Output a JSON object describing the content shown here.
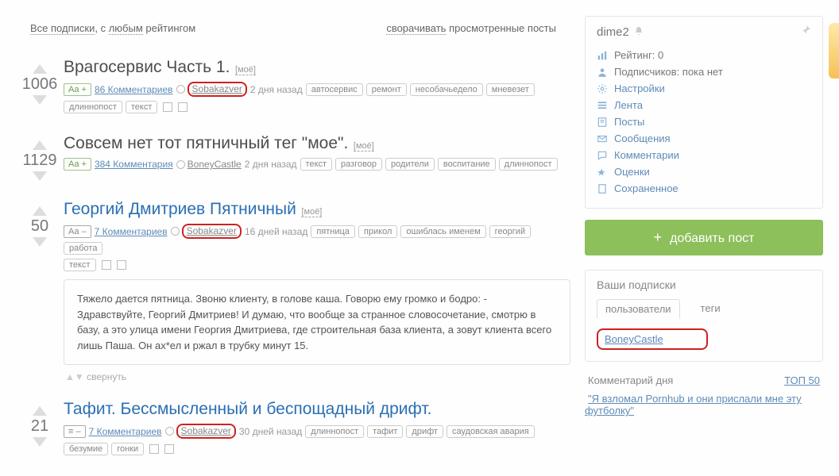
{
  "filter": {
    "all_subs": "Все подписки",
    "with": ", с",
    "any": "любым",
    "rating": "рейтингом",
    "collapse": "сворачивать",
    "viewed": "просмотренные посты"
  },
  "posts": [
    {
      "score": "1006",
      "title": "Врагосервис Часть 1.",
      "title_link": false,
      "moe": "[моё]",
      "aa": "Aa +",
      "aa_plus": true,
      "comments": "86 Комментариев",
      "author": "Sobakazver",
      "author_circled": true,
      "time": "2 дня назад",
      "tags": [
        "автосервис",
        "ремонт",
        "несобачьедело",
        "мневезет"
      ],
      "tags2": [
        "длиннопост",
        "текст"
      ]
    },
    {
      "score": "1129",
      "title": "Совсем нет тот пятничный тег \"мое\".",
      "title_link": false,
      "moe": "[моё]",
      "aa": "Aa +",
      "aa_plus": true,
      "comments": "384 Комментария",
      "author": "BoneyCastle",
      "author_circled": false,
      "time": "2 дня назад",
      "tags": [
        "текст",
        "разговор",
        "родители",
        "воспитание",
        "длиннопост"
      ],
      "tags2": []
    },
    {
      "score": "50",
      "title": "Георгий Дмитриев Пятничный",
      "title_link": true,
      "moe": "[моё]",
      "aa": "Aa –",
      "aa_plus": false,
      "comments": "7 Комментариев",
      "author": "Sobakazver",
      "author_circled": true,
      "time": "16 дней назад",
      "tags": [
        "пятница",
        "прикол",
        "ошиблась именем",
        "георгий",
        "работа"
      ],
      "tags2": [
        "текст"
      ],
      "excerpt": "Тяжело дается пятница. Звоню клиенту, в голове каша. Говорю ему громко и бодро: - Здравствуйте, Георгий Дмитриев! И думаю, что вообще за странное словосочетание, смотрю в базу, а это улица имени Георгия Дмитриева, где строительная база клиента, а зовут клиента всего лишь Паша. Он ах*ел и ржал в трубку минут 15.",
      "collapse": "свернуть"
    },
    {
      "score": "21",
      "title": "Тафит. Бессмысленный и беспощадный дрифт.",
      "title_link": true,
      "moe": "",
      "aa": "≡ –",
      "aa_plus": false,
      "comments": "7 Комментариев",
      "author": "Sobakazver",
      "author_circled": true,
      "time": "30 дней назад",
      "tags": [
        "длиннопост",
        "тафит",
        "дрифт",
        "саудовская авария"
      ],
      "tags2": [
        "безумие",
        "гонки"
      ]
    }
  ],
  "user": {
    "name": "dime2",
    "rating_label": "Рейтинг:",
    "rating_value": "0",
    "subs_label": "Подписчиков:",
    "subs_value": "пока нет",
    "links": [
      "Настройки",
      "Лента",
      "Посты",
      "Сообщения",
      "Комментарии",
      "Оценки",
      "Сохраненное"
    ]
  },
  "add_post": "добавить пост",
  "your_subs": {
    "title": "Ваши подписки",
    "tabs": [
      "пользователи",
      "теги"
    ],
    "link": "BoneyCastle"
  },
  "cod": {
    "title": "Комментарий дня",
    "top": "ТОП 50",
    "text": "\"Я взломал Pornhub и они прислали мне эту футболку\""
  }
}
